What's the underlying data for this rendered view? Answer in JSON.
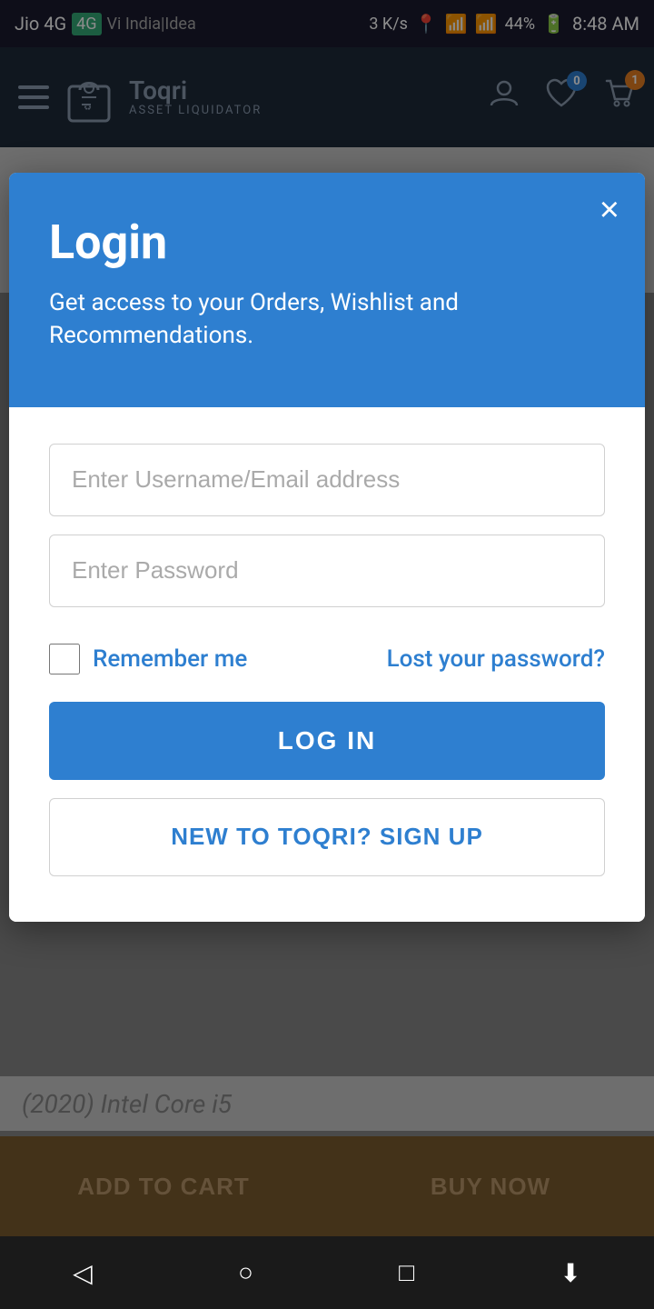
{
  "status_bar": {
    "carrier1": "Jio 4G",
    "carrier2": "Vi India|Idea",
    "speed": "3 K/s",
    "battery": "44%",
    "time": "8:48 AM"
  },
  "navbar": {
    "logo_name": "Toqri",
    "logo_sub": "ASSET LIQUIDATOR",
    "wishlist_count": "0",
    "cart_count": "1"
  },
  "modal": {
    "close_label": "×",
    "title": "Login",
    "subtitle": "Get access to your Orders, Wishlist and Recommendations.",
    "email_placeholder": "Enter Username/Email address",
    "password_placeholder": "Enter Password",
    "remember_label": "Remember me",
    "forgot_label": "Lost your password?",
    "login_button": "LOG IN",
    "signup_button": "NEW TO TOQRI? SIGN UP"
  },
  "bottom_bar": {
    "add_to_cart": "ADD TO CART",
    "buy_now": "BUY NOW"
  },
  "product_price": "(2020) Intel Core i5",
  "android_nav": {
    "back": "◁",
    "home": "○",
    "recent": "□",
    "down": "⬇"
  }
}
